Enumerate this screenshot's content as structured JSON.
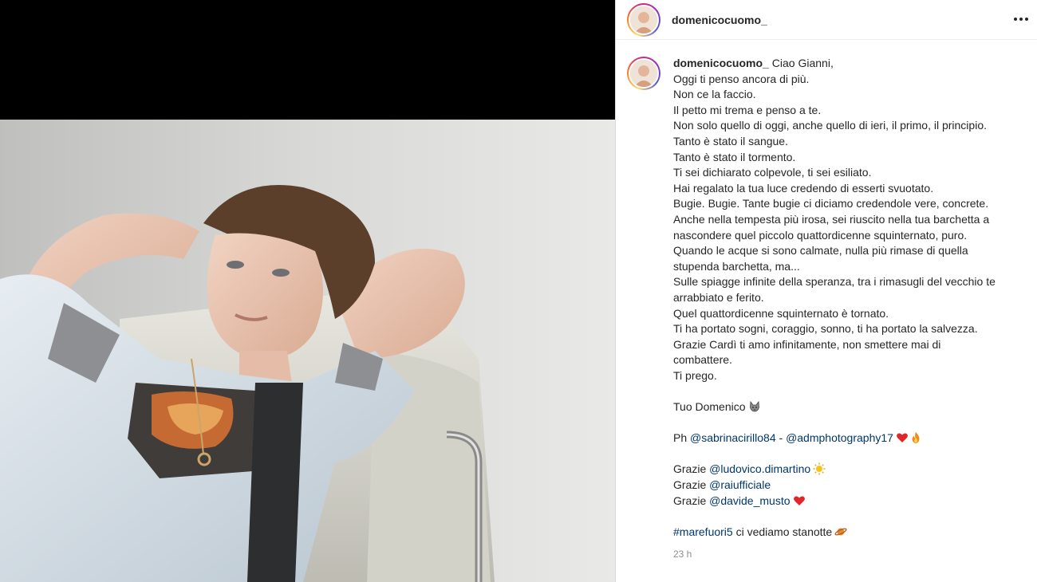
{
  "post": {
    "author": "domenicocuomo_",
    "more_label": "More options",
    "caption_lines": [
      "Ciao Gianni,",
      "Oggi ti penso ancora di più.",
      "Non ce la faccio.",
      "Il petto mi trema e penso a te.",
      "Non solo quello di oggi, anche quello di ieri, il primo, il principio.",
      "Tanto è stato il sangue.",
      "Tanto è stato il tormento.",
      "Ti sei dichiarato colpevole, ti sei esiliato.",
      "Hai regalato la tua luce credendo di esserti svuotato.",
      "Bugie. Bugie. Tante bugie ci diciamo credendole vere, concrete.",
      "Anche nella tempesta più irosa, sei riuscito nella tua barchetta a",
      "nascondere quel piccolo quattordicenne squinternato, puro.",
      "Quando le acque si sono calmate, nulla più rimase di quella",
      "stupenda barchetta, ma...",
      "Sulle spiagge infinite della speranza, tra i rimasugli del vecchio te",
      "arrabbiato e ferito.",
      "Quel quattordicenne squinternato è tornato.",
      "Ti ha portato sogni, coraggio, sonno, ti ha portato la salvezza.",
      "Grazie Cardì ti amo infinitamente, non smettere mai di",
      "combattere.",
      "Ti prego."
    ],
    "signature": "Tuo Domenico",
    "credits": {
      "prefix": "Ph ",
      "mention1": "@sabrinacirillo84",
      "separator": " - ",
      "mention2": "@admphotography17"
    },
    "thanks": [
      {
        "prefix": "Grazie ",
        "mention": "@ludovico.dimartino",
        "emoji": "sun-icon"
      },
      {
        "prefix": "Grazie ",
        "mention": "@raiufficiale",
        "emoji": ""
      },
      {
        "prefix": "Grazie ",
        "mention": "@davide_musto",
        "emoji": "red-heart-icon"
      }
    ],
    "hashtag": "#marefuori5",
    "hashtag_suffix": " ci vediamo stanotte",
    "timestamp": "23 h"
  },
  "colors": {
    "link": "#00376b",
    "text": "#262626",
    "muted": "#8e8e8e",
    "divider": "#dbdbdb"
  }
}
